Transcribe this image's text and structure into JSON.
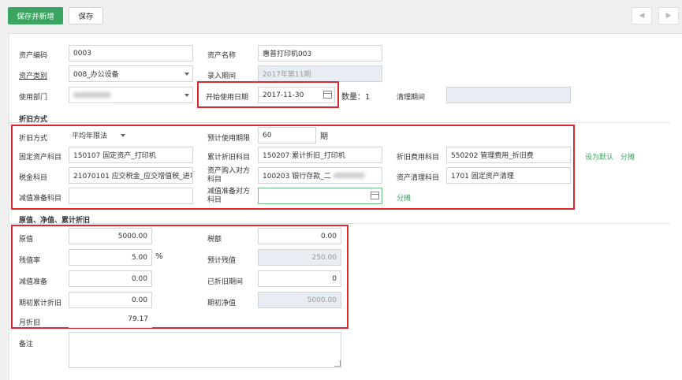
{
  "toolbar": {
    "save_new": "保存并新增",
    "save": "保存",
    "prev": "◀",
    "next": "▶"
  },
  "basic": {
    "code_label": "资产编码",
    "code_value": "0003",
    "name_label": "资产名称",
    "name_value": "惠普打印机003",
    "category_label": "资产类别",
    "category_value": "008_办公设备",
    "entry_label": "录入期间",
    "entry_value": "2017年第11期",
    "dept_label": "使用部门",
    "start_label": "开始使用日期",
    "start_value": "2017-11-30",
    "qty_label": "数量：1",
    "clear_label": "清理期间"
  },
  "depr": {
    "section": "折旧方式",
    "method_label": "折旧方式",
    "method_value": "平均年限法",
    "life_label": "预计使用期限",
    "life_value": "60",
    "life_unit": "期",
    "fixed_label": "固定资产科目",
    "fixed_value": "150107 固定资产_打印机",
    "acc_label": "累计折旧科目",
    "acc_value": "150207 累计折旧_打印机",
    "expense_label": "折旧费用科目",
    "expense_value": "550202 管理费用_折旧费",
    "set_default": "设为默认",
    "split1": "分摊",
    "tax_label": "税金科目",
    "tax_value": "21070101 应交税金_应交增值税_进项",
    "purchase_label": "资产购入对方科目",
    "purchase_value": "100203 银行存款_二",
    "cleanup_label": "资产清理科目",
    "cleanup_value": "1701 固定资产清理",
    "impair_label": "减值准备科目",
    "impair_contra_label": "减值准备对方科目",
    "split2": "分摊"
  },
  "values": {
    "section": "原值、净值、累计折旧",
    "original_label": "原值",
    "original_value": "5000.00",
    "taxamt_label": "税额",
    "taxamt_value": "0.00",
    "residual_rate_label": "残值率",
    "residual_rate_value": "5.00",
    "pct": "%",
    "est_residual_label": "预计残值",
    "est_residual_value": "250.00",
    "impair_label": "减值准备",
    "impair_value": "0.00",
    "depr_periods_label": "已折旧期间",
    "depr_periods_value": "0",
    "init_acc_label": "期初累计折旧",
    "init_acc_value": "0.00",
    "init_net_label": "期初净值",
    "init_net_value": "5000.00",
    "monthly_label": "月折旧",
    "monthly_value": "79.17"
  },
  "notes": {
    "label": "备注"
  }
}
